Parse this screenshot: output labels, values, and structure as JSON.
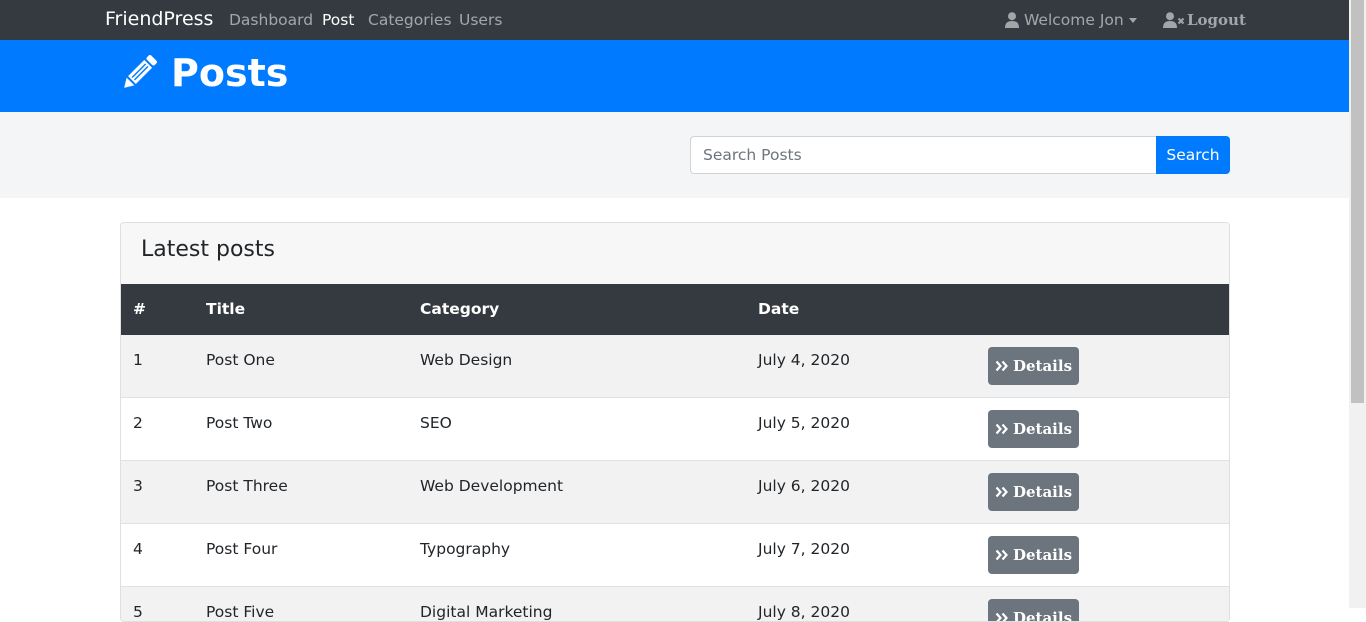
{
  "navbar": {
    "brand": "FriendPress",
    "links": [
      {
        "label": "Dashboard",
        "active": false
      },
      {
        "label": "Post",
        "active": true
      },
      {
        "label": "Categories",
        "active": false
      },
      {
        "label": "Users",
        "active": false
      }
    ],
    "user_menu": {
      "label": "Welcome Jon",
      "icon": "user-icon"
    },
    "logout": {
      "label": "Logout",
      "icon": "user-times-icon"
    }
  },
  "header": {
    "title": "Posts",
    "icon": "pencil-icon"
  },
  "search": {
    "placeholder": "Search Posts",
    "value": "",
    "button_label": "Search"
  },
  "posts_card": {
    "title": "Latest posts",
    "columns": [
      "#",
      "Title",
      "Category",
      "Date",
      ""
    ],
    "rows": [
      {
        "num": "1",
        "title": "Post One",
        "category": "Web Design",
        "date": "July 4, 2020",
        "action": "Details"
      },
      {
        "num": "2",
        "title": "Post Two",
        "category": "SEO",
        "date": "July 5, 2020",
        "action": "Details"
      },
      {
        "num": "3",
        "title": "Post Three",
        "category": "Web Development",
        "date": "July 6, 2020",
        "action": "Details"
      },
      {
        "num": "4",
        "title": "Post Four",
        "category": "Typography",
        "date": "July 7, 2020",
        "action": "Details"
      },
      {
        "num": "5",
        "title": "Post Five",
        "category": "Digital Marketing",
        "date": "July 8, 2020",
        "action": "Details"
      }
    ]
  },
  "colors": {
    "navbar_bg": "#343a40",
    "header_bg": "#007bff",
    "primary": "#007bff",
    "secondary_button": "#6c757d",
    "table_head_bg": "#343a40"
  }
}
